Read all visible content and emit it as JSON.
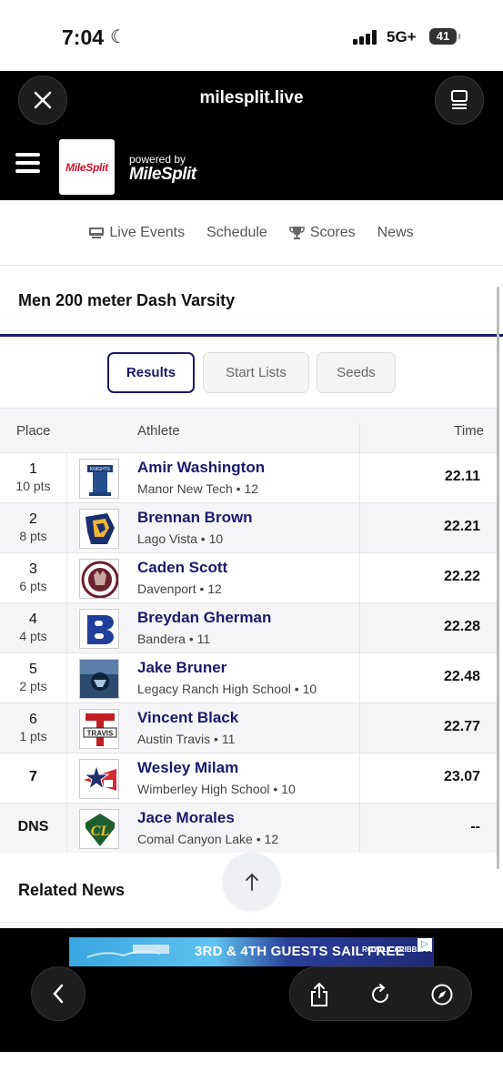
{
  "status_bar": {
    "time": "7:04",
    "network": "5G+",
    "battery": "41"
  },
  "browser": {
    "url": "milesplit.live"
  },
  "site": {
    "logo_text": "MileSplit",
    "powered_by_label": "powered by",
    "powered_by_brand": "MileSplit"
  },
  "nav": [
    {
      "label": "Live Events",
      "icon": "live-icon"
    },
    {
      "label": "Schedule",
      "icon": ""
    },
    {
      "label": "Scores",
      "icon": "trophy-icon"
    },
    {
      "label": "News",
      "icon": ""
    }
  ],
  "event": {
    "title": "Men 200 meter Dash Varsity"
  },
  "tabs": [
    {
      "label": "Results",
      "active": true
    },
    {
      "label": "Start Lists",
      "active": false
    },
    {
      "label": "Seeds",
      "active": false
    }
  ],
  "table": {
    "headers": {
      "place": "Place",
      "athlete": "Athlete",
      "time": "Time"
    },
    "rows": [
      {
        "place": "1",
        "pts": "10 pts",
        "name": "Amir Washington",
        "team": "Manor New Tech • 12",
        "time": "22.11",
        "logo": "manor-logo"
      },
      {
        "place": "2",
        "pts": "8 pts",
        "name": "Brennan Brown",
        "team": "Lago Vista • 10",
        "time": "22.21",
        "logo": "lago-vista-logo"
      },
      {
        "place": "3",
        "pts": "6 pts",
        "name": "Caden Scott",
        "team": "Davenport • 12",
        "time": "22.22",
        "logo": "davenport-logo"
      },
      {
        "place": "4",
        "pts": "4 pts",
        "name": "Breydan Gherman",
        "team": "Bandera • 11",
        "time": "22.28",
        "logo": "bandera-logo"
      },
      {
        "place": "5",
        "pts": "2 pts",
        "name": "Jake Bruner",
        "team": "Legacy Ranch High School • 10",
        "time": "22.48",
        "logo": "legacy-ranch-logo"
      },
      {
        "place": "6",
        "pts": "1 pts",
        "name": "Vincent Black",
        "team": "Austin Travis • 11",
        "time": "22.77",
        "logo": "travis-logo"
      },
      {
        "place": "7",
        "pts": "",
        "name": "Wesley Milam",
        "team": "Wimberley High School • 10",
        "time": "23.07",
        "logo": "wimberley-logo"
      },
      {
        "place": "DNS",
        "pts": "",
        "name": "Jace Morales",
        "team": "Comal Canyon Lake • 12",
        "time": "--",
        "logo": "canyon-lake-logo"
      }
    ]
  },
  "related": {
    "title": "Related News"
  },
  "ad": {
    "text": "3RD & 4TH GUESTS SAIL FREE",
    "brand": "ROYAL CARIBBEAN"
  }
}
